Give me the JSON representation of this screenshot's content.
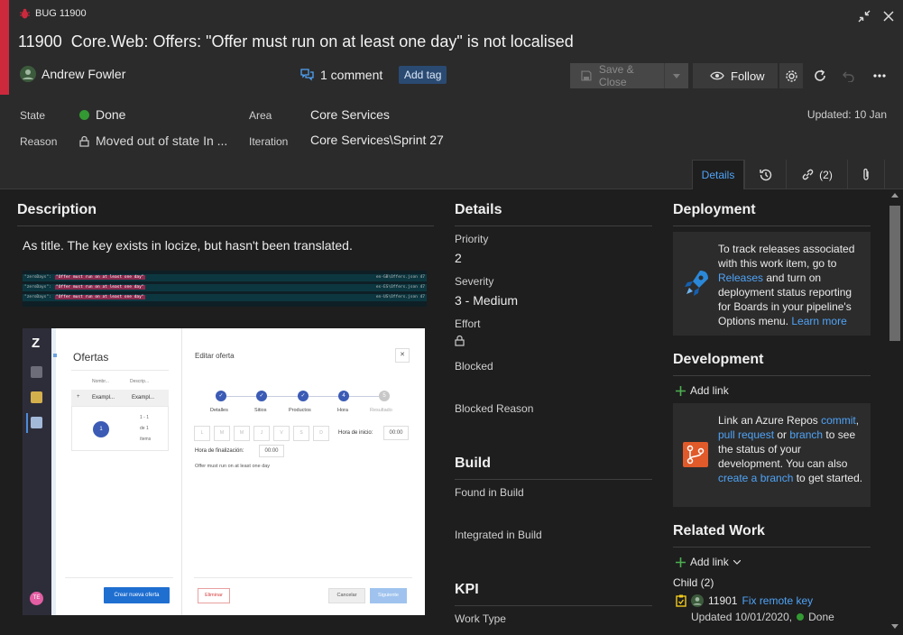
{
  "header": {
    "type_label": "BUG 11900",
    "id": "11900",
    "title": "Core.Web: Offers: \"Offer must run on at least one day\" is not localised",
    "author": "Andrew Fowler",
    "comments": "1 comment",
    "add_tag": "Add tag",
    "save_close": "Save & Close",
    "follow": "Follow"
  },
  "fields": {
    "state_label": "State",
    "state_value": "Done",
    "reason_label": "Reason",
    "reason_value": "Moved out of state In ...",
    "area_label": "Area",
    "area_value": "Core Services",
    "iteration_label": "Iteration",
    "iteration_value": "Core Services\\Sprint 27",
    "updated": "Updated: 10 Jan"
  },
  "tabs": {
    "details": "Details",
    "links": "(2)"
  },
  "description": {
    "title": "Description",
    "text": "As title.  The key exists in locize, but hasn't been translated.",
    "code_rows": [
      {
        "key": "\"zeroDays\":",
        "val": "\"Offer must run on at least one day\"",
        "path": "en-GB\\Offers.json 47"
      },
      {
        "key": "\"zeroDays\":",
        "val": "\"Offer must run on at least one day\"",
        "path": "es-ES\\Offers.json 47"
      },
      {
        "key": "\"zeroDays\":",
        "val": "\"Offer must run on at least one day\"",
        "path": "en-US\\Offers.json 47"
      }
    ],
    "mock": {
      "logo": "Z",
      "offers_title": "Ofertas",
      "col1": "Nombr...",
      "col2": "Descrip...",
      "row1": "Exampl...",
      "row2": "Exampl...",
      "page": "1",
      "range1": "1 - 1",
      "range2": "de 1",
      "range3": "ítems",
      "create_btn": "Crear nueva oferta",
      "avatar": "TE",
      "edit_title": "Editar oferta",
      "steps": [
        "Detalles",
        "Sitios",
        "Productos",
        "Hora",
        "Resultado"
      ],
      "step4_num": "4",
      "step5_num": "5",
      "days": [
        "L",
        "M",
        "M",
        "J",
        "V",
        "S",
        "D"
      ],
      "start_label": "Hora de inicio:",
      "start_val": "00:00",
      "end_label": "Hora de finalización:",
      "end_val": "00:00",
      "error": "Offer must run on at least one day",
      "delete_btn": "Eliminar",
      "cancel_btn": "Cancelar",
      "next_btn": "Siguiente"
    }
  },
  "details": {
    "title": "Details",
    "priority_label": "Priority",
    "priority_value": "2",
    "severity_label": "Severity",
    "severity_value": "3 - Medium",
    "effort_label": "Effort",
    "blocked_label": "Blocked",
    "blocked_reason_label": "Blocked Reason"
  },
  "build": {
    "title": "Build",
    "found_label": "Found in Build",
    "integrated_label": "Integrated in Build"
  },
  "kpi": {
    "title": "KPI",
    "worktype_label": "Work Type"
  },
  "deployment": {
    "title": "Deployment",
    "t1": "To track releases associated with this work item, go to ",
    "link1": "Releases",
    "t2": " and turn on deployment status reporting for Boards in your pipeline's Options menu. ",
    "link2": "Learn more"
  },
  "development": {
    "title": "Development",
    "add_link": "Add link",
    "t1": "Link an Azure Repos ",
    "link_commit": "commit",
    "t2": ", ",
    "link_pr": "pull request",
    "t3": " or ",
    "link_branch": "branch",
    "t4": " to see the status of your development. You can also ",
    "link_create": "create a branch",
    "t5": " to get started."
  },
  "related": {
    "title": "Related Work",
    "add_link": "Add link",
    "child_label": "Child (2)",
    "item_id": "11901",
    "item_title": "Fix remote key",
    "item_updated": "Updated 10/01/2020,",
    "item_state": "Done"
  },
  "colors": {
    "accent": "#4fa3f7",
    "bug_red": "#cc293d",
    "done_green": "#339933"
  }
}
